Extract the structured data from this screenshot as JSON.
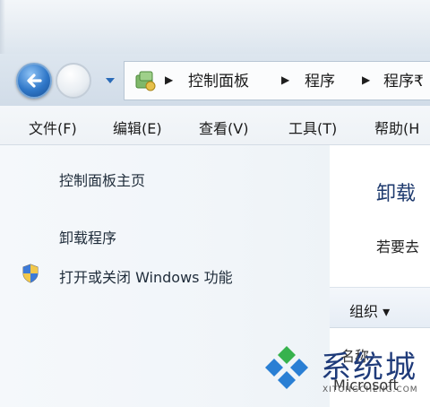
{
  "window": {
    "title_ghost": ""
  },
  "address_bar": {
    "crumbs": [
      "控制面板",
      "程序",
      "程序₹"
    ]
  },
  "menu": {
    "items": [
      "文件(F)",
      "编辑(E)",
      "查看(V)",
      "工具(T)",
      "帮助(H"
    ]
  },
  "left_nav": {
    "items": [
      "控制面板主页",
      "卸载程序",
      "打开或关闭 Windows 功能"
    ]
  },
  "content": {
    "title": "卸载",
    "description": "若要去",
    "toolbar_organize": "组织 ▾",
    "column_header": "名称",
    "row_partial": "Microsoft"
  },
  "watermark": {
    "text": "系统城",
    "sub": "XITONGCHENG.COM"
  },
  "colors": {
    "accent_blue": "#2f77c8",
    "link_text": "#1f2c3a",
    "content_title": "#1e3a6e",
    "watermark_blue": "#1f3b7a",
    "watermark_green": "#37b24d"
  }
}
